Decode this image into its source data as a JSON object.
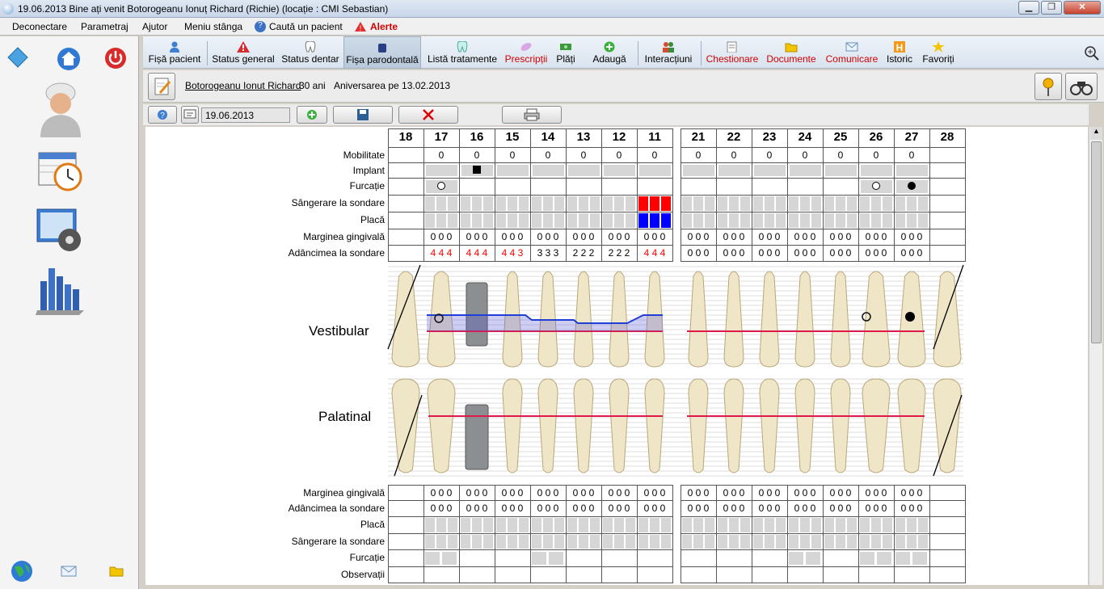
{
  "window": {
    "title": "19.06.2013 Bine ați venit Botorogeanu Ionuț Richard (Richie) (locație : CMI Sebastian)",
    "minimize": "▁",
    "maximize": "❐",
    "close": "✕"
  },
  "menu": [
    "Deconectare",
    "Parametraj",
    "Ajutor",
    "Meniu stânga",
    "Caută un pacient",
    "Alerte"
  ],
  "toolbar": [
    {
      "label": "Fișă pacient",
      "icon": "person-icon",
      "color": "#000000"
    },
    {
      "label": "Status general",
      "icon": "warning-icon",
      "color": "#000000"
    },
    {
      "label": "Status dentar",
      "icon": "tooth-icon",
      "color": "#000000"
    },
    {
      "label": "Fișa parodontală",
      "icon": "gum-icon",
      "color": "#000000"
    },
    {
      "label": "Listă tratamente",
      "icon": "tooth-list-icon",
      "color": "#000000"
    },
    {
      "label": "Prescripții",
      "icon": "pills-icon",
      "color": "#d00000"
    },
    {
      "label": "Plăți",
      "icon": "money-icon",
      "color": "#000000"
    },
    {
      "label": "Adaugă",
      "icon": "add-icon",
      "color": "#000000"
    },
    {
      "label": "Interacțiuni",
      "icon": "people-icon",
      "color": "#000000"
    },
    {
      "label": "Chestionare",
      "icon": "form-icon",
      "color": "#d00000"
    },
    {
      "label": "Documente",
      "icon": "folder-icon",
      "color": "#d00000"
    },
    {
      "label": "Comunicare",
      "icon": "mail-icon",
      "color": "#d00000"
    },
    {
      "label": "Istoric",
      "icon": "history-icon",
      "color": "#000000"
    },
    {
      "label": "Favoriți",
      "icon": "star-icon",
      "color": "#000000"
    }
  ],
  "patient": {
    "name": "Botorogeanu Ionut Richard",
    "age": "30 ani",
    "birthday": "Aniversarea pe 13.02.2013"
  },
  "controls": {
    "date": "19.06.2013"
  },
  "periodontal": {
    "upper_left_teeth": [
      "18",
      "17",
      "16",
      "15",
      "14",
      "13",
      "12",
      "11"
    ],
    "upper_right_teeth": [
      "21",
      "22",
      "23",
      "24",
      "25",
      "26",
      "27",
      "28"
    ],
    "rows_top": [
      "Mobilitate",
      "Implant",
      "Furcație",
      "Sângerare la sondare",
      "Placă",
      "Marginea gingivală",
      "Adâncimea la sondare"
    ],
    "mobility_left": [
      "",
      "0",
      "0",
      "0",
      "0",
      "0",
      "0",
      "0"
    ],
    "mobility_right": [
      "0",
      "0",
      "0",
      "0",
      "0",
      "0",
      "0",
      ""
    ],
    "margin_top_left": [
      "",
      "0 0 0",
      "0 0 0",
      "0 0 0",
      "0 0 0",
      "0 0 0",
      "0 0 0",
      "0 0 0"
    ],
    "margin_top_right": [
      "0 0 0",
      "0 0 0",
      "0 0 0",
      "0 0 0",
      "0 0 0",
      "0 0 0",
      "0 0 0",
      ""
    ],
    "depth_top_left": [
      "",
      "4 4 4",
      "4 4 4",
      "4 4 3",
      "3 3 3",
      "2 2 2",
      "2 2 2",
      "4 4 4"
    ],
    "depth_top_right": [
      "0 0 0",
      "0 0 0",
      "0 0 0",
      "0 0 0",
      "0 0 0",
      "0 0 0",
      "0 0 0",
      ""
    ],
    "vestibular_label": "Vestibular",
    "palatinal_label": "Palatinal",
    "rows_bottom": [
      "Marginea gingivală",
      "Adâncimea la sondare",
      "Placă",
      "Sângerare la sondare",
      "Furcație",
      "Observații"
    ],
    "margin_bottom_left": [
      "",
      "0 0 0",
      "0 0 0",
      "0 0 0",
      "0 0 0",
      "0 0 0",
      "0 0 0",
      "0 0 0"
    ],
    "margin_bottom_right": [
      "0 0 0",
      "0 0 0",
      "0 0 0",
      "0 0 0",
      "0 0 0",
      "0 0 0",
      "0 0 0",
      ""
    ],
    "depth_bottom_left": [
      "",
      "0 0 0",
      "0 0 0",
      "0 0 0",
      "0 0 0",
      "0 0 0",
      "0 0 0",
      "0 0 0"
    ],
    "depth_bottom_right": [
      "0 0 0",
      "0 0 0",
      "0 0 0",
      "0 0 0",
      "0 0 0",
      "0 0 0",
      "0 0 0",
      ""
    ],
    "colors": {
      "bleeding": "#ff0000",
      "plaque": "#0000ff",
      "depth_alert": "#ff0000",
      "gum_line": "#e0194c",
      "probing_line": "#1f3fd6"
    }
  }
}
